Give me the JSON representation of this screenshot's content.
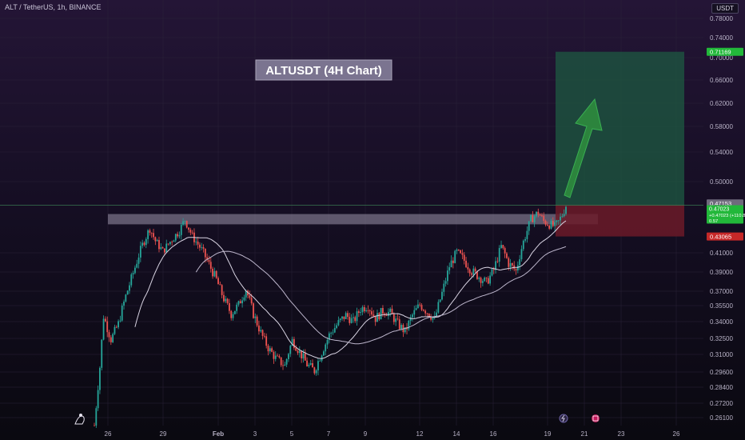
{
  "header": {
    "symbol_line": "ALT / TetherUS, 1h, BINANCE",
    "currency": "USDT"
  },
  "annotation": {
    "text": "ALTUSDT (4H Chart)"
  },
  "chart_data": {
    "type": "candlestick",
    "symbol": "ALT / TetherUS",
    "interval": "1h",
    "exchange": "BINANCE",
    "quote_currency": "USDT",
    "y_axis": {
      "ticks": [
        "0.78000",
        "0.74000",
        "0.70000",
        "0.66000",
        "0.62000",
        "0.58000",
        "0.54000",
        "0.50000",
        "0.41000",
        "0.39000",
        "0.37000",
        "0.35500",
        "0.34000",
        "0.32500",
        "0.31000",
        "0.29600",
        "0.28400",
        "0.27200",
        "0.26100"
      ]
    },
    "x_axis": {
      "ticks": [
        "26",
        "29",
        "Feb",
        "3",
        "5",
        "7",
        "9",
        "12",
        "14",
        "16",
        "19",
        "21",
        "23",
        "26"
      ]
    },
    "price_labels": {
      "target": "0.71169",
      "last": "0.47153",
      "entry": "0.47023",
      "entry_change": "+0.47023 (+110.80%)",
      "entry_sub": "0.57",
      "stop": "0.43065"
    },
    "resistance_zone": {
      "low": 0.446,
      "high": 0.459
    },
    "position": {
      "entry": 0.47023,
      "target": 0.71169,
      "stop": 0.43065
    },
    "colors": {
      "up": "#26a69a",
      "down": "#ef5350",
      "target_zone": "#1e5a42",
      "stop_zone": "#6b1a28",
      "arrow": "#2e8b3e",
      "target_label": "#22b83a",
      "stop_label": "#c62828"
    },
    "price_path": [
      [
        0,
        0.255
      ],
      [
        3,
        0.3
      ],
      [
        5,
        0.345
      ],
      [
        9,
        0.324
      ],
      [
        13,
        0.338
      ],
      [
        17,
        0.365
      ],
      [
        22,
        0.395
      ],
      [
        26,
        0.42
      ],
      [
        30,
        0.441
      ],
      [
        33,
        0.425
      ],
      [
        37,
        0.412
      ],
      [
        41,
        0.424
      ],
      [
        46,
        0.438
      ],
      [
        49,
        0.452
      ],
      [
        53,
        0.431
      ],
      [
        58,
        0.414
      ],
      [
        62,
        0.398
      ],
      [
        66,
        0.382
      ],
      [
        70,
        0.362
      ],
      [
        74,
        0.347
      ],
      [
        78,
        0.356
      ],
      [
        82,
        0.372
      ],
      [
        86,
        0.347
      ],
      [
        90,
        0.33
      ],
      [
        94,
        0.316
      ],
      [
        98,
        0.307
      ],
      [
        103,
        0.301
      ],
      [
        107,
        0.323
      ],
      [
        111,
        0.312
      ],
      [
        115,
        0.302
      ],
      [
        119,
        0.297
      ],
      [
        123,
        0.312
      ],
      [
        127,
        0.328
      ],
      [
        132,
        0.339
      ],
      [
        136,
        0.346
      ],
      [
        140,
        0.34
      ],
      [
        144,
        0.352
      ],
      [
        148,
        0.355
      ],
      [
        152,
        0.343
      ],
      [
        156,
        0.35
      ],
      [
        160,
        0.348
      ],
      [
        164,
        0.338
      ],
      [
        168,
        0.331
      ],
      [
        172,
        0.346
      ],
      [
        176,
        0.356
      ],
      [
        180,
        0.349
      ],
      [
        184,
        0.342
      ],
      [
        188,
        0.368
      ],
      [
        192,
        0.396
      ],
      [
        196,
        0.411
      ],
      [
        200,
        0.402
      ],
      [
        204,
        0.391
      ],
      [
        208,
        0.385
      ],
      [
        212,
        0.379
      ],
      [
        216,
        0.392
      ],
      [
        220,
        0.418
      ],
      [
        224,
        0.399
      ],
      [
        228,
        0.391
      ],
      [
        232,
        0.424
      ],
      [
        236,
        0.452
      ],
      [
        240,
        0.461
      ],
      [
        243,
        0.45
      ],
      [
        246,
        0.446
      ],
      [
        249,
        0.443
      ],
      [
        251,
        0.449
      ],
      [
        253,
        0.458
      ],
      [
        255,
        0.47
      ]
    ]
  }
}
